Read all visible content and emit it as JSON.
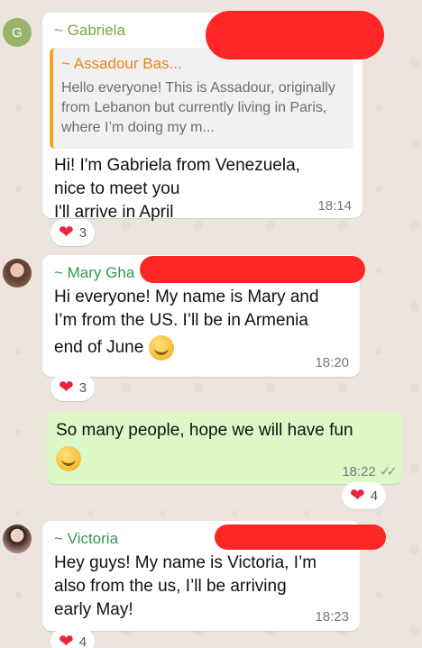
{
  "messages": [
    {
      "avatar_letter": "G",
      "sender": "~ Gabriela",
      "sender_color": "#76a83a",
      "quote": {
        "sender": "~ Assadour Bas...",
        "text": "Hello everyone! This is Assadour, originally from Lebanon but currently living in Paris, where I’m doing my m..."
      },
      "lines": [
        "Hi! I'm Gabriela from Venezuela,",
        "nice to meet you",
        "I'll arrive in April"
      ],
      "time": "18:14",
      "reaction_count": "3"
    },
    {
      "sender": "~ Mary Gha",
      "sender_color": "#2f9a4f",
      "lines": [
        "Hi everyone! My name is Mary and",
        "I’m from the US. I’ll be in Armenia",
        "end of June"
      ],
      "emoji_name": "grinning-face-emoji",
      "time": "18:20",
      "reaction_count": "3"
    },
    {
      "outgoing": true,
      "lines": [
        "So many people, hope we will have fun"
      ],
      "emoji_name": "smiling-face-emoji",
      "time": "18:22",
      "reaction_count": "4"
    },
    {
      "sender": "~ Victoria",
      "sender_color": "#2f9a4f",
      "lines": [
        "Hey guys! My name is Victoria, I’m",
        "also from the us, I’ll be arriving",
        "early May!"
      ],
      "time": "18:23",
      "reaction_count": "4"
    }
  ],
  "icons": {
    "heart": "heart-icon",
    "read": "double-check-icon"
  }
}
